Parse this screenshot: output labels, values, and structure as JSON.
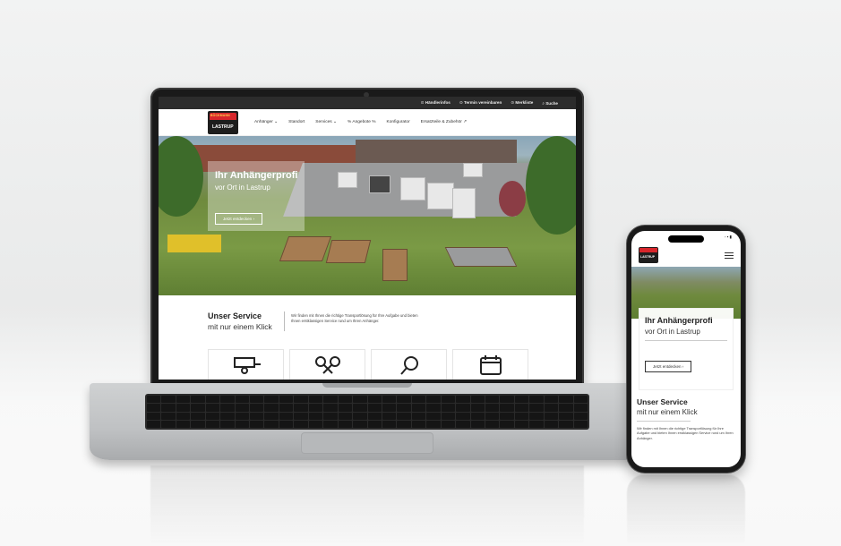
{
  "laptop": {
    "topbar": [
      {
        "icon": "handshake-icon",
        "label": "Händlerinfos"
      },
      {
        "icon": "calendar-icon",
        "label": "Termin vereinbaren"
      },
      {
        "icon": "cart-icon",
        "label": "Merkliste"
      },
      {
        "icon": "search-icon",
        "label": "Suche"
      }
    ],
    "logo": {
      "top": "BÖCKMANN",
      "name": "LASTRUP"
    },
    "nav": [
      "Anhänger ⌄",
      "Standort",
      "Services ⌄",
      "% Angebote %",
      "Konfigurator",
      "Ersatzteile & Zubehör ↗"
    ],
    "hero": {
      "title": "Ihr Anhängerprofi",
      "subtitle": "vor Ort in Lastrup",
      "cta": "Jetzt entdecken  ›"
    },
    "service": {
      "title": "Unser Service",
      "subtitle": "mit nur einem Klick",
      "desc": "Wir finden mit Ihnen die richtige Transportlösung für Ihre Aufgabe und bieten Ihnen erstklassigen Service rund um Ihren Anhänger."
    },
    "cards": [
      {
        "icon": "trailer-icon"
      },
      {
        "icon": "wrench-icon"
      },
      {
        "icon": "key-icon"
      },
      {
        "icon": "calendar-icon"
      }
    ]
  },
  "phone": {
    "status": {
      "time": "",
      "icons": "◦ ▪ ▮"
    },
    "hero": {
      "title": "Ihr Anhängerprofi",
      "subtitle": "vor Ort in Lastrup",
      "cta": "Jetzt entdecken  ›"
    },
    "service": {
      "title": "Unser Service",
      "subtitle": "mit nur einem Klick",
      "desc": "Wir finden mit Ihnen die richtige Transportlösung für Ihre Aufgabe und bieten Ihnen erstklassigen Service rund um Ihren Anhänger."
    }
  },
  "colors": {
    "brand_red": "#d7262b",
    "brand_yellow": "#ffd34d",
    "dark": "#2c2c2c"
  }
}
